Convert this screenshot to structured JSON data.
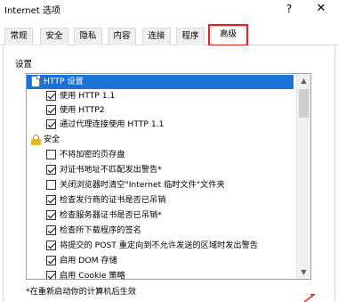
{
  "window": {
    "title": "Internet 选项",
    "help_glyph": "?",
    "close_glyph": "✕"
  },
  "tabs": [
    {
      "label": "常规",
      "active": false
    },
    {
      "label": "安全",
      "active": false
    },
    {
      "label": "隐私",
      "active": false
    },
    {
      "label": "内容",
      "active": false
    },
    {
      "label": "连接",
      "active": false
    },
    {
      "label": "程序",
      "active": false
    },
    {
      "label": "高级",
      "active": true
    }
  ],
  "highlight_color": "#e0241b",
  "settings": {
    "label": "设置",
    "items": [
      {
        "label": "HTTP 设置",
        "kind": "group",
        "icon": "document-icon",
        "selected": true
      },
      {
        "label": "使用 HTTP 1.1",
        "kind": "checkbox",
        "checked": true
      },
      {
        "label": "使用 HTTP2",
        "kind": "checkbox",
        "checked": true
      },
      {
        "label": "通过代理连接使用 HTTP 1.1",
        "kind": "checkbox",
        "checked": true
      },
      {
        "label": "安全",
        "kind": "group",
        "icon": "lock-icon",
        "selected": false
      },
      {
        "label": "不将加密的页存盘",
        "kind": "checkbox",
        "checked": false
      },
      {
        "label": "对证书地址不匹配发出警告*",
        "kind": "checkbox",
        "checked": true
      },
      {
        "label": "关闭浏览器时清空\"Internet 临时文件\"文件夹",
        "kind": "checkbox",
        "checked": false
      },
      {
        "label": "检查发行商的证书是否已吊销",
        "kind": "checkbox",
        "checked": true
      },
      {
        "label": "检查服务器证书是否已吊销*",
        "kind": "checkbox",
        "checked": true
      },
      {
        "label": "检查所下载程序的签名",
        "kind": "checkbox",
        "checked": true
      },
      {
        "label": "将提交的 POST 重定向到不允许发送的区域时发出警告",
        "kind": "checkbox",
        "checked": true
      },
      {
        "label": "启用 DOM 存储",
        "kind": "checkbox",
        "checked": true
      },
      {
        "label": "启用 Cookie 策略",
        "kind": "checkbox",
        "checked": true
      }
    ]
  },
  "note": "*在重新启动你的计算机后生效"
}
